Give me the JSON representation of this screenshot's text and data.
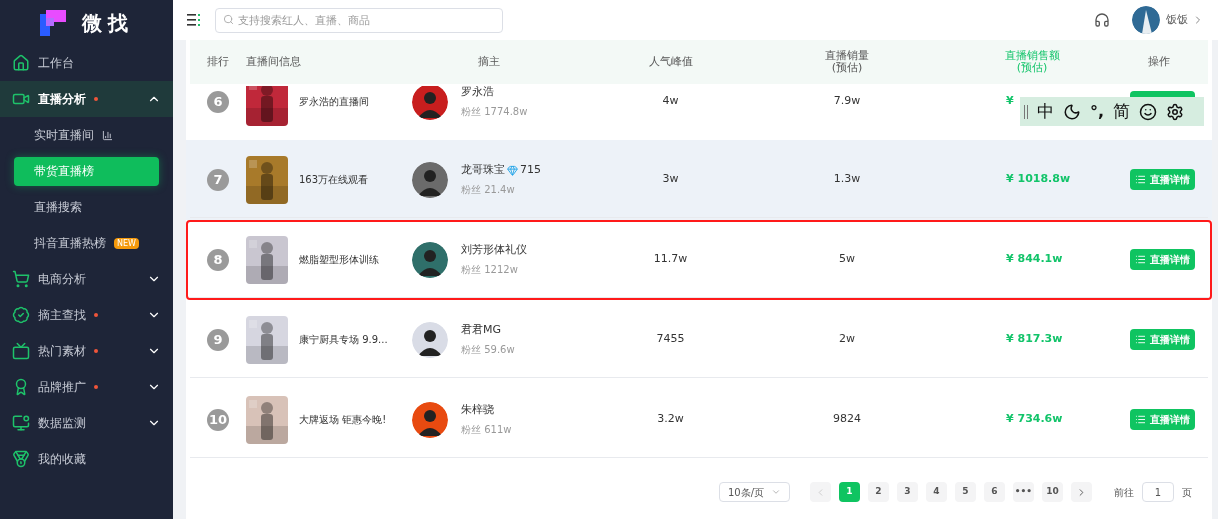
{
  "logo": {
    "text": "微找"
  },
  "sidebar": {
    "items": [
      {
        "label": "工作台",
        "dot": false
      },
      {
        "label": "直播分析",
        "dot": true,
        "expanded": true,
        "children": [
          {
            "label": "实时直播间",
            "selected": false,
            "live": true
          },
          {
            "label": "带货直播榜",
            "selected": true
          },
          {
            "label": "直播搜索",
            "selected": false
          },
          {
            "label": "抖音直播热榜",
            "selected": false,
            "badge": "NEW"
          }
        ]
      },
      {
        "label": "电商分析",
        "dot": false,
        "expanded": false
      },
      {
        "label": "摘主查找",
        "dot": true,
        "expanded": false
      },
      {
        "label": "热门素材",
        "dot": true,
        "expanded": false
      },
      {
        "label": "品牌推广",
        "dot": true,
        "expanded": false
      },
      {
        "label": "数据监测",
        "dot": false,
        "expanded": false
      },
      {
        "label": "我的收藏",
        "dot": false
      }
    ]
  },
  "topbar": {
    "search": {
      "placeholder": "支持搜索红人、直播、商品"
    },
    "user": {
      "name": "饭饭"
    }
  },
  "table": {
    "columns": [
      "排行",
      "直播间信息",
      "摘主",
      "人气峰值",
      "直播销量\n(预估)",
      "直播销售额\n(预估)",
      "操作"
    ],
    "rows": [
      {
        "rank": "6",
        "title": "罗永浩的直播间",
        "host": "罗永浩",
        "fans": "粉丝 1774.8w",
        "peak": "4w",
        "sales": "7.9w",
        "amount": "¥",
        "clipped": true,
        "highlighted": false,
        "hovered": false
      },
      {
        "rank": "7",
        "title": "163万在线观看",
        "host": "龙哥珠宝",
        "level": "715",
        "fans": "粉丝 21.4w",
        "peak": "3w",
        "sales": "1.3w",
        "amount": "¥ 1018.8w",
        "action": "直播详情",
        "clipped": false,
        "highlighted": false,
        "hovered": true
      },
      {
        "rank": "8",
        "title": "燃脂塑型形体训练",
        "host": "刘芳形体礼仪",
        "fans": "粉丝 1212w",
        "peak": "11.7w",
        "sales": "5w",
        "amount": "¥ 844.1w",
        "action": "直播详情",
        "clipped": false,
        "highlighted": true,
        "hovered": false
      },
      {
        "rank": "9",
        "title": "康宁厨具专场 9.9...",
        "host": "君君MG",
        "fans": "粉丝 59.6w",
        "peak": "7455",
        "sales": "2w",
        "amount": "¥ 817.3w",
        "action": "直播详情",
        "clipped": false,
        "highlighted": false,
        "hovered": false
      },
      {
        "rank": "10",
        "title": "大牌返场 钜惠今晚!",
        "host": "朱梓骁",
        "fans": "粉丝 611w",
        "peak": "3.2w",
        "sales": "9824",
        "amount": "¥ 734.6w",
        "action": "直播详情",
        "clipped": false,
        "highlighted": false,
        "hovered": false
      }
    ]
  },
  "pagination": {
    "page_size": "10条/页",
    "pages": [
      {
        "label": "1",
        "selected": true
      },
      {
        "label": "2",
        "selected": false
      },
      {
        "label": "3",
        "selected": false
      },
      {
        "label": "4",
        "selected": false
      },
      {
        "label": "5",
        "selected": false
      },
      {
        "label": "6",
        "selected": false
      },
      {
        "label": "•••",
        "selected": false
      },
      {
        "label": "10",
        "selected": false
      }
    ],
    "prev_disabled": true,
    "goto_label": "前往",
    "goto_value": "1",
    "goto_suffix": "页"
  },
  "ime_toolbar": {
    "mode": "中",
    "punctuation": "°,",
    "script": "简"
  }
}
